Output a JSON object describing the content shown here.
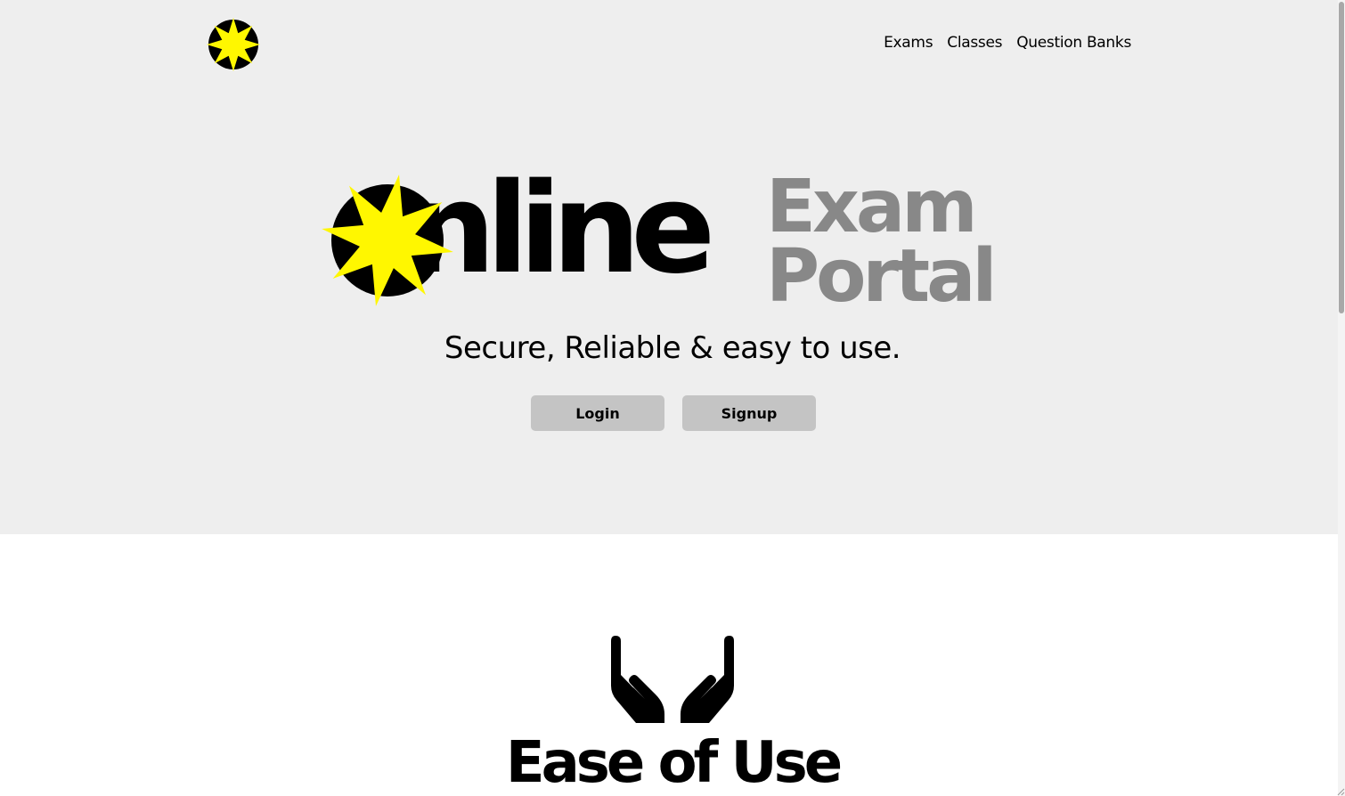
{
  "header": {
    "logo_icon": "star-in-circle-icon",
    "nav": [
      {
        "label": "Exams"
      },
      {
        "label": "Classes"
      },
      {
        "label": "Question Banks"
      }
    ]
  },
  "hero": {
    "brand_word": "nline",
    "brand_line1": "Exam",
    "brand_line2": "Portal",
    "tagline": "Secure, Reliable & easy to use.",
    "login_label": "Login",
    "signup_label": "Signup"
  },
  "feature": {
    "icon": "open-hands-icon",
    "title": "Ease of Use"
  },
  "colors": {
    "hero_bg": "#eeeeee",
    "accent_yellow": "#fff700",
    "brand_gray": "#888888",
    "button_bg": "#c4c4c4"
  }
}
